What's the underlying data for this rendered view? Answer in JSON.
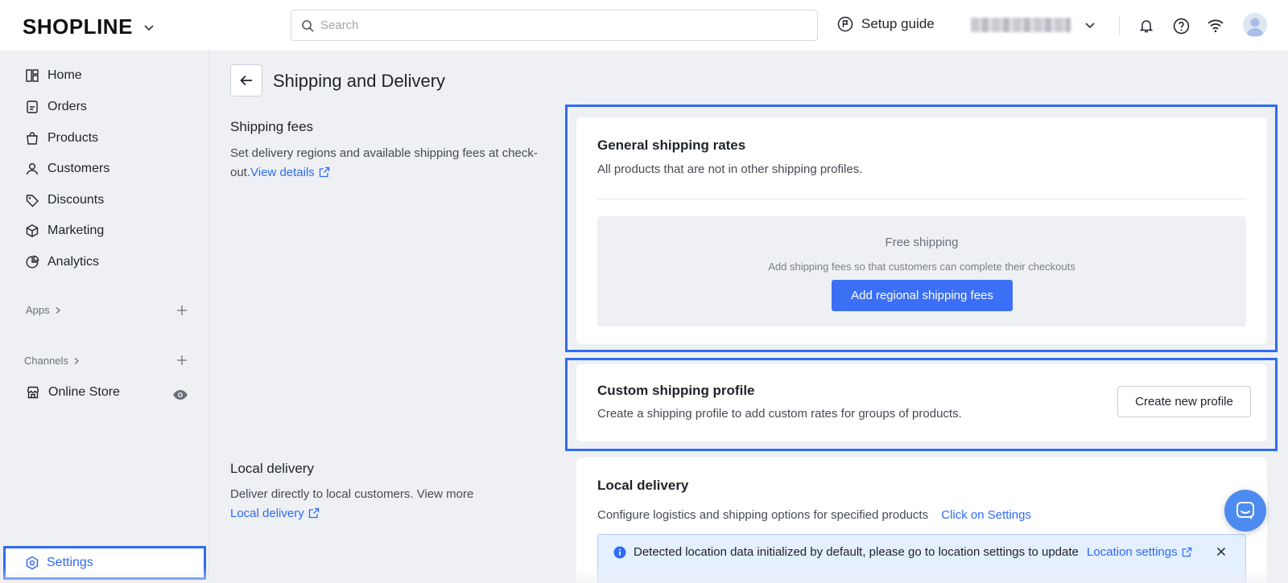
{
  "header": {
    "logo": "SHOPLINE",
    "search_placeholder": "Search",
    "setup_guide": "Setup guide",
    "icons": [
      "bell-icon",
      "help-icon",
      "wifi-icon",
      "avatar"
    ]
  },
  "sidebar": {
    "items": [
      {
        "label": "Home",
        "icon": "home-icon"
      },
      {
        "label": "Orders",
        "icon": "orders-icon"
      },
      {
        "label": "Products",
        "icon": "bag-icon"
      },
      {
        "label": "Customers",
        "icon": "person-icon"
      },
      {
        "label": "Discounts",
        "icon": "tag-icon"
      },
      {
        "label": "Marketing",
        "icon": "cube-icon"
      },
      {
        "label": "Analytics",
        "icon": "pie-icon"
      }
    ],
    "apps_label": "Apps",
    "channels_label": "Channels",
    "online_store": "Online Store",
    "settings": "Settings"
  },
  "page": {
    "title": "Shipping and Delivery"
  },
  "shipping_fees": {
    "title": "Shipping fees",
    "desc": "Set delivery regions and available shipping fees at check-out.",
    "link": "View details"
  },
  "general_rates": {
    "title": "General shipping rates",
    "desc": "All products that are not in other shipping profiles.",
    "empty_title": "Free shipping",
    "empty_desc": "Add shipping fees so that customers can complete their checkouts",
    "button": "Add regional shipping fees"
  },
  "custom_profile": {
    "title": "Custom shipping profile",
    "desc": "Create a shipping profile to add custom rates for groups of products.",
    "button": "Create new profile"
  },
  "local_section": {
    "title": "Local delivery",
    "desc": "Deliver directly to local customers. View more",
    "link": "Local delivery"
  },
  "local_card": {
    "title": "Local delivery",
    "desc": "Configure logistics and shipping options for specified products",
    "link": "Click on Settings",
    "notice": "Detected location data initialized by default, please go to location settings to update",
    "notice_link": "Location settings"
  },
  "colors": {
    "accent": "#2f6bf4",
    "primary_button": "#3b6ff5",
    "background": "#eef0f4"
  }
}
